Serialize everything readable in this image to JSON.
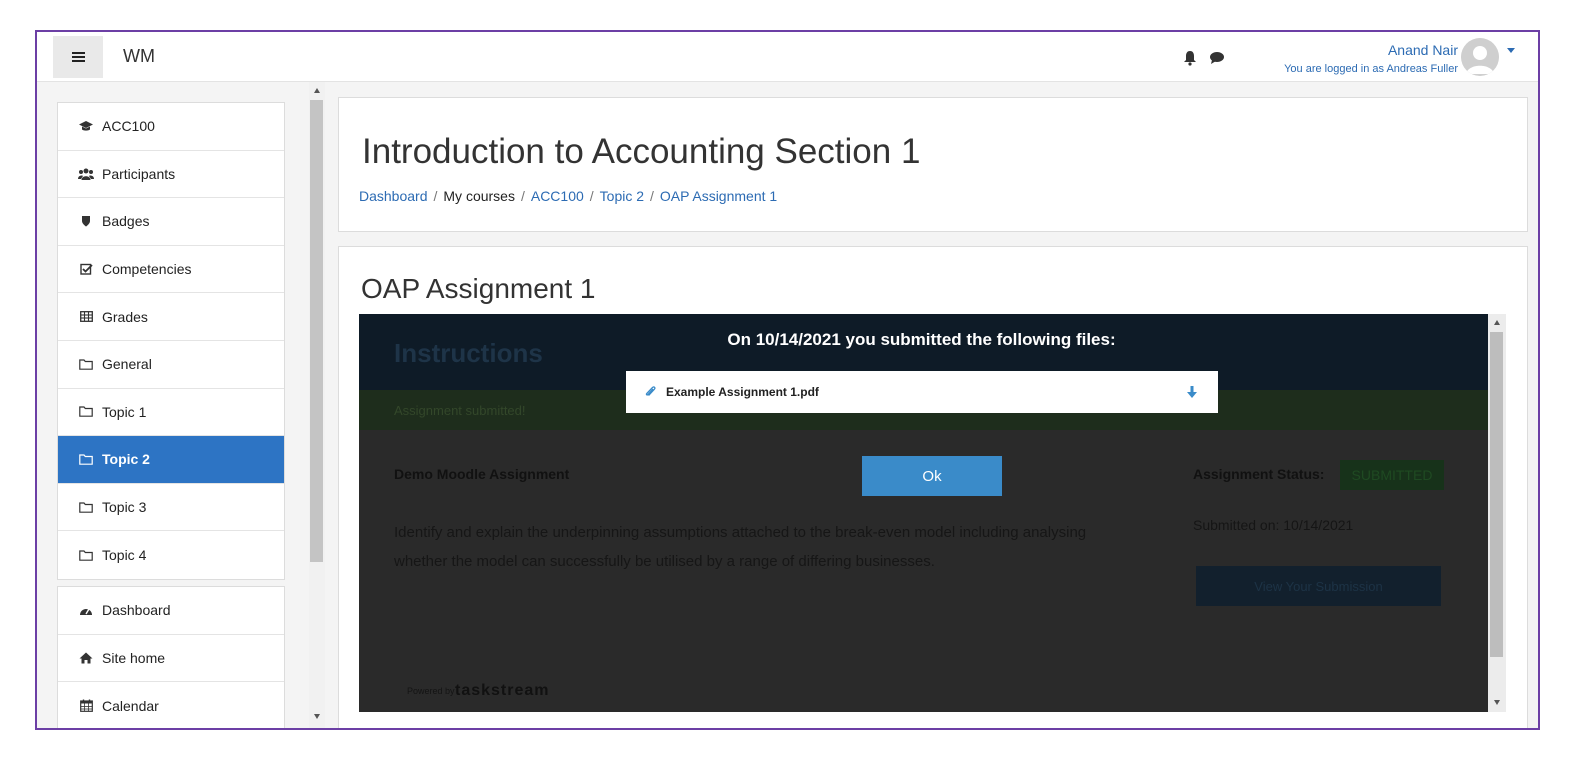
{
  "navbar": {
    "brand": "WM",
    "user_name": "Anand Nair",
    "logged_in_as": "You are logged in as Andreas Fuller"
  },
  "drawer": {
    "course_items": [
      {
        "label": "ACC100",
        "icon": "graduation-cap-icon"
      },
      {
        "label": "Participants",
        "icon": "users-icon"
      },
      {
        "label": "Badges",
        "icon": "shield-icon"
      },
      {
        "label": "Competencies",
        "icon": "check-square-icon"
      },
      {
        "label": "Grades",
        "icon": "table-icon"
      },
      {
        "label": "General",
        "icon": "folder-icon"
      },
      {
        "label": "Topic 1",
        "icon": "folder-icon"
      },
      {
        "label": "Topic 2",
        "icon": "folder-icon",
        "active": true
      },
      {
        "label": "Topic 3",
        "icon": "folder-icon"
      },
      {
        "label": "Topic 4",
        "icon": "folder-icon"
      }
    ],
    "site_items": [
      {
        "label": "Dashboard",
        "icon": "tachometer-icon"
      },
      {
        "label": "Site home",
        "icon": "home-icon"
      },
      {
        "label": "Calendar",
        "icon": "calendar-icon"
      }
    ]
  },
  "header": {
    "title": "Introduction to Accounting Section 1",
    "breadcrumb": [
      "Dashboard",
      "My courses",
      "ACC100",
      "Topic 2",
      "OAP Assignment 1"
    ]
  },
  "activity": {
    "title": "OAP Assignment 1"
  },
  "lti": {
    "instructions_heading": "Instructions",
    "submitted_banner": "Assignment submitted!",
    "assignment_name": "Demo Moodle Assignment",
    "description": "Identify and explain the underpinning assumptions attached to the break-even model including analysing whether the model can successfully be utilised by a range of differing businesses.",
    "status_label": "Assignment Status:",
    "status_badge": "SUBMITTED",
    "submitted_on": "Submitted on: 10/14/2021",
    "view_button": "View Your Submission",
    "powered_by": "Powered by",
    "logo_text": "taskstream"
  },
  "modal": {
    "heading": "On 10/14/2021 you submitted the following files:",
    "file_name": "Example Assignment 1.pdf",
    "ok_label": "Ok"
  },
  "colors": {
    "accent": "#2d74c4",
    "link": "#2c6bb3",
    "ok_button": "#3a8bc9",
    "frame_border": "#6c3fa5"
  }
}
